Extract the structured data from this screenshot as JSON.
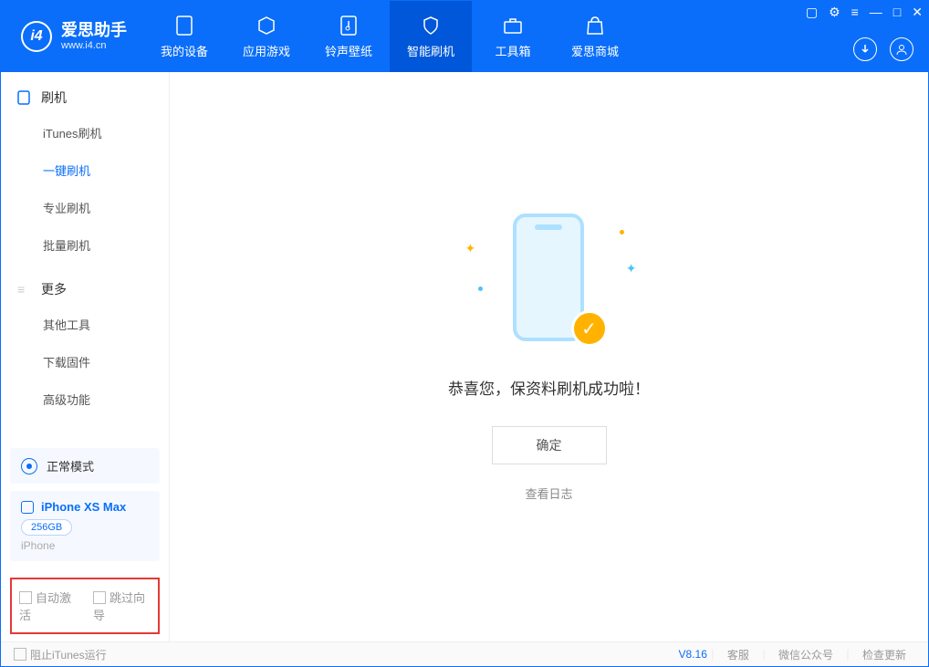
{
  "app": {
    "name": "爱思助手",
    "url": "www.i4.cn"
  },
  "header_tabs": {
    "t0": "我的设备",
    "t1": "应用游戏",
    "t2": "铃声壁纸",
    "t3": "智能刷机",
    "t4": "工具箱",
    "t5": "爱思商城"
  },
  "sidebar": {
    "section1": "刷机",
    "items1": {
      "a": "iTunes刷机",
      "b": "一键刷机",
      "c": "专业刷机",
      "d": "批量刷机"
    },
    "section2": "更多",
    "items2": {
      "a": "其他工具",
      "b": "下载固件",
      "c": "高级功能"
    }
  },
  "mode": {
    "label": "正常模式"
  },
  "device": {
    "name": "iPhone XS Max",
    "storage": "256GB",
    "type": "iPhone"
  },
  "options": {
    "auto_activate": "自动激活",
    "skip_guide": "跳过向导"
  },
  "content": {
    "success": "恭喜您，保资料刷机成功啦！",
    "ok": "确定",
    "log": "查看日志"
  },
  "footer": {
    "block_itunes": "阻止iTunes运行",
    "version": "V8.16",
    "service": "客服",
    "wechat": "微信公众号",
    "update": "检查更新"
  }
}
